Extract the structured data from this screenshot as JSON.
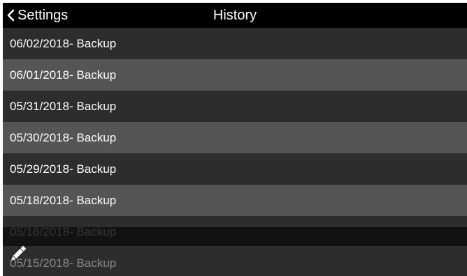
{
  "header": {
    "back_label": "Settings",
    "title": "History"
  },
  "history": {
    "items": [
      {
        "label": "06/02/2018- Backup"
      },
      {
        "label": "06/01/2018- Backup"
      },
      {
        "label": "05/31/2018- Backup"
      },
      {
        "label": "05/30/2018- Backup"
      },
      {
        "label": "05/29/2018- Backup"
      },
      {
        "label": "05/18/2018- Backup"
      },
      {
        "label": "05/16/2018- Backup"
      },
      {
        "label": "05/15/2018- Backup"
      }
    ]
  },
  "toolbar": {
    "edit_icon": "pencil-icon"
  },
  "colors": {
    "header_bg": "#000000",
    "row_dark": "#2d2d2d",
    "row_light": "#555555",
    "text": "#ffffff"
  }
}
